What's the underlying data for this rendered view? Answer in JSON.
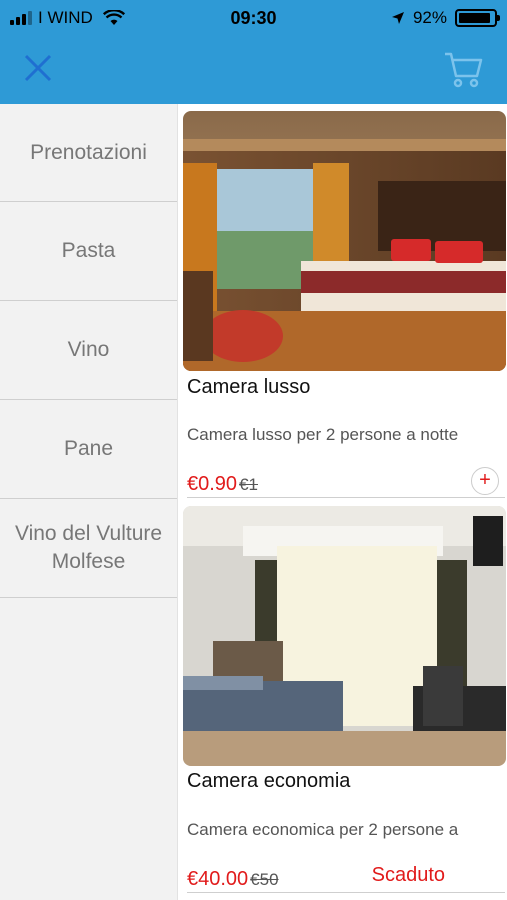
{
  "status": {
    "carrier": "I WIND",
    "time": "09:30",
    "battery": "92%",
    "battery_level": 0.92
  },
  "header": {
    "close_icon": "close-icon",
    "cart_icon": "cart-icon",
    "accent": "#2e9ad6"
  },
  "sidebar": {
    "items": [
      {
        "label": "Prenotazioni"
      },
      {
        "label": "Pasta"
      },
      {
        "label": "Vino"
      },
      {
        "label": "Pane"
      },
      {
        "label": "Vino del Vulture Molfese"
      }
    ]
  },
  "products": [
    {
      "name": "Camera lusso",
      "description": "Camera lusso per 2 persone a notte",
      "price": "€0.90",
      "old_price": "€1",
      "action": "+"
    },
    {
      "name": "Camera economia",
      "description": "Camera economica per 2 persone a",
      "price": "€40.00",
      "old_price": "€50",
      "status": "Scaduto"
    }
  ]
}
